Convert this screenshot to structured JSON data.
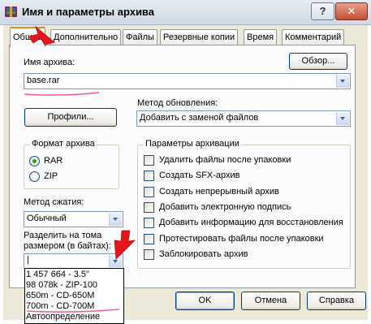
{
  "window": {
    "title": "Имя и параметры архива",
    "help_label": "?",
    "close_label": "✕"
  },
  "tabs": [
    {
      "label": "Общие",
      "active": true
    },
    {
      "label": "Дополнительно"
    },
    {
      "label": "Файлы"
    },
    {
      "label": "Резервные копии"
    },
    {
      "label": "Время"
    },
    {
      "label": "Комментарий"
    }
  ],
  "archive": {
    "name_label": "Имя архива:",
    "name_value": "base.rar",
    "browse_label": "Обзор..."
  },
  "profiles_label": "Профили...",
  "update_method": {
    "label": "Метод обновления:",
    "value": "Добавить с заменой файлов"
  },
  "format": {
    "legend": "Формат архива",
    "options": [
      {
        "label": "RAR",
        "checked": true
      },
      {
        "label": "ZIP",
        "checked": false
      }
    ]
  },
  "compression": {
    "label": "Метод сжатия:",
    "value": "Обычный"
  },
  "split": {
    "label_line1": "Разделить на тома",
    "label_line2": "размером (в байтах):",
    "value": "|",
    "options": [
      "1 457 664 - 3.5\"",
      "98 078k - ZIP-100",
      "650m - CD-650M",
      "700m - CD-700M",
      "Автоопределение"
    ]
  },
  "params": {
    "legend": "Параметры архивации",
    "options": [
      {
        "label": "Удалить файлы после упаковки",
        "checked": false
      },
      {
        "label": "Создать SFX-архив",
        "checked": false
      },
      {
        "label": "Создать непрерывный архив",
        "checked": false
      },
      {
        "label": "Добавить электронную подпись",
        "checked": false
      },
      {
        "label": "Добавить информацию для восстановления",
        "checked": false
      },
      {
        "label": "Протестировать файлы после упаковки",
        "checked": false
      },
      {
        "label": "Заблокировать архив",
        "checked": false
      }
    ]
  },
  "buttons": {
    "ok": "OK",
    "cancel": "Отмена",
    "help": "Справка"
  },
  "colors": {
    "annotation_red": "#e4161b",
    "underline_pink": "#ee3f7a",
    "tab_highlight": "#e68b2c",
    "dialog_bg": "#ece9d8"
  }
}
